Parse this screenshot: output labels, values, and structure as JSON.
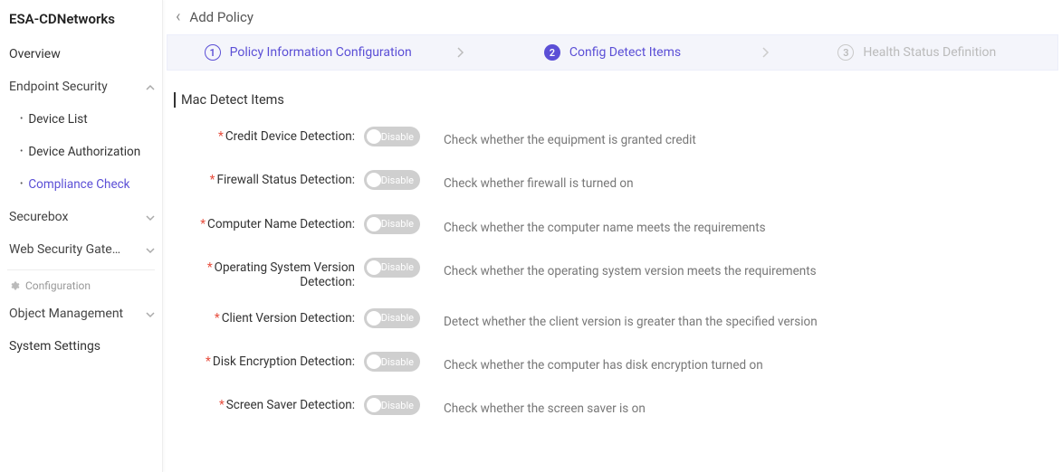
{
  "brand": "ESA-CDNetworks",
  "sidebar": {
    "overview": "Overview",
    "endpoint_security": "Endpoint Security",
    "endpoint_items": [
      {
        "label": "Device List"
      },
      {
        "label": "Device Authorization"
      },
      {
        "label": "Compliance Check"
      }
    ],
    "securebox": "Securebox",
    "web_security_gateway": "Web Security Gatew...",
    "configuration": "Configuration",
    "object_management": "Object Management",
    "system_settings": "System Settings"
  },
  "header": {
    "title": "Add Policy"
  },
  "stepper": {
    "steps": [
      {
        "num": "1",
        "label": "Policy Information Configuration"
      },
      {
        "num": "2",
        "label": "Config Detect Items"
      },
      {
        "num": "3",
        "label": "Health Status Definition"
      }
    ]
  },
  "section_title": "Mac Detect Items",
  "toggle_text": "Disable",
  "items": [
    {
      "label": "Credit Device Detection:",
      "desc": "Check whether the equipment is granted credit"
    },
    {
      "label": "Firewall Status Detection:",
      "desc": "Check whether firewall is turned on"
    },
    {
      "label": "Computer Name Detection:",
      "desc": "Check whether the computer name meets the requirements"
    },
    {
      "label": "Operating System Version Detection:",
      "desc": "Check whether the operating system version meets the requirements"
    },
    {
      "label": "Client Version Detection:",
      "desc": "Detect whether the client version is greater than the specified version"
    },
    {
      "label": "Disk Encryption Detection:",
      "desc": "Check whether the computer has disk encryption turned on"
    },
    {
      "label": "Screen Saver Detection:",
      "desc": "Check whether the screen saver is on"
    }
  ]
}
